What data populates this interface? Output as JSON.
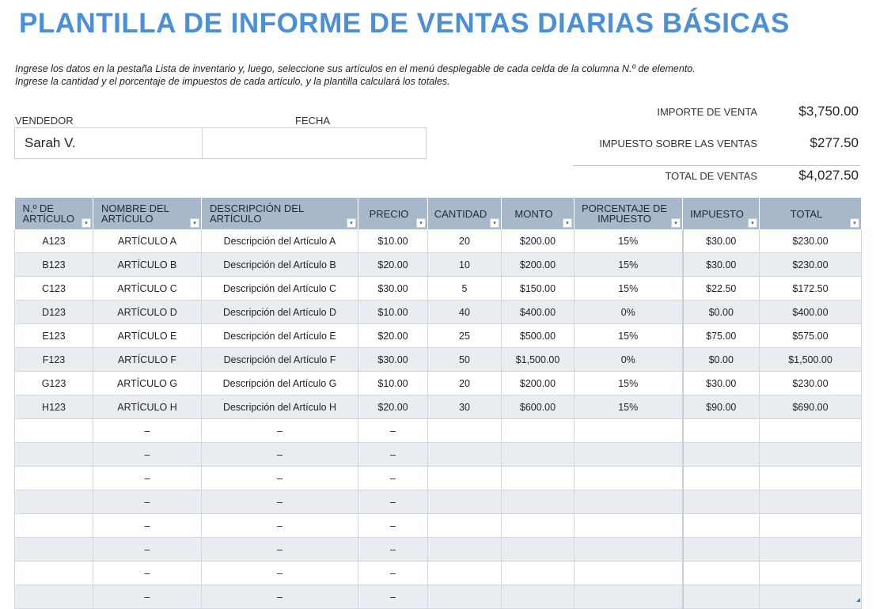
{
  "title": "PLANTILLA DE INFORME DE VENTAS DIARIAS BÁSICAS",
  "instructions": [
    "Ingrese los datos en la pestaña Lista de inventario y, luego, seleccione sus artículos en el menú desplegable de cada celda de la columna N.º de elemento.",
    "Ingrese la cantidad y el porcentaje de impuestos de cada artículo, y la plantilla calculará los totales."
  ],
  "vendor": {
    "label": "VENDEDOR",
    "value": "Sarah V."
  },
  "date": {
    "label": "FECHA",
    "value": ""
  },
  "summary": {
    "sale_amount": {
      "label": "IMPORTE DE VENTA",
      "value": "$3,750.00"
    },
    "sales_tax": {
      "label": "IMPUESTO SOBRE LAS VENTAS",
      "value": "$277.50"
    },
    "total_sales": {
      "label": "TOTAL DE VENTAS",
      "value": "$4,027.50"
    }
  },
  "table": {
    "headers": [
      {
        "line1": "N.º DE",
        "line2": "ARTÍCULO"
      },
      {
        "line1": "NOMBRE DEL",
        "line2": "ARTÍCULO"
      },
      {
        "line1": "DESCRIPCIÓN DEL",
        "line2": "ARTÍCULO"
      },
      {
        "line1": "PRECIO",
        "line2": ""
      },
      {
        "line1": "CANTIDAD",
        "line2": ""
      },
      {
        "line1": "MONTO",
        "line2": ""
      },
      {
        "line1": "PORCENTAJE DE",
        "line2": "IMPUESTO"
      },
      {
        "line1": "IMPUESTO",
        "line2": ""
      },
      {
        "line1": "TOTAL",
        "line2": ""
      }
    ],
    "dropdown_glyph": "▾",
    "rows": [
      [
        "A123",
        "ARTÍCULO A",
        "Descripción del Artículo A",
        "$10.00",
        "20",
        "$200.00",
        "15%",
        "$30.00",
        "$230.00"
      ],
      [
        "B123",
        "ARTÍCULO B",
        "Descripción del Artículo B",
        "$20.00",
        "10",
        "$200.00",
        "15%",
        "$30.00",
        "$230.00"
      ],
      [
        "C123",
        "ARTÍCULO C",
        "Descripción del Artículo C",
        "$30.00",
        "5",
        "$150.00",
        "15%",
        "$22.50",
        "$172.50"
      ],
      [
        "D123",
        "ARTÍCULO D",
        "Descripción del Artículo D",
        "$10.00",
        "40",
        "$400.00",
        "0%",
        "$0.00",
        "$400.00"
      ],
      [
        "E123",
        "ARTÍCULO E",
        "Descripción del Artículo E",
        "$20.00",
        "25",
        "$500.00",
        "15%",
        "$75.00",
        "$575.00"
      ],
      [
        "F123",
        "ARTÍCULO F",
        "Descripción del Artículo F",
        "$30.00",
        "50",
        "$1,500.00",
        "0%",
        "$0.00",
        "$1,500.00"
      ],
      [
        "G123",
        "ARTÍCULO G",
        "Descripción del Artículo G",
        "$10.00",
        "20",
        "$200.00",
        "15%",
        "$30.00",
        "$230.00"
      ],
      [
        "H123",
        "ARTÍCULO H",
        "Descripción del Artículo H",
        "$20.00",
        "30",
        "$600.00",
        "15%",
        "$90.00",
        "$690.00"
      ],
      [
        "",
        "–",
        "–",
        "–",
        "",
        "",
        "",
        "",
        ""
      ],
      [
        "",
        "–",
        "–",
        "–",
        "",
        "",
        "",
        "",
        ""
      ],
      [
        "",
        "–",
        "–",
        "–",
        "",
        "",
        "",
        "",
        ""
      ],
      [
        "",
        "–",
        "–",
        "–",
        "",
        "",
        "",
        "",
        ""
      ],
      [
        "",
        "–",
        "–",
        "–",
        "",
        "",
        "",
        "",
        ""
      ],
      [
        "",
        "–",
        "–",
        "–",
        "",
        "",
        "",
        "",
        ""
      ],
      [
        "",
        "–",
        "–",
        "–",
        "",
        "",
        "",
        "",
        ""
      ],
      [
        "",
        "–",
        "–",
        "–",
        "",
        "",
        "",
        "",
        ""
      ]
    ]
  }
}
